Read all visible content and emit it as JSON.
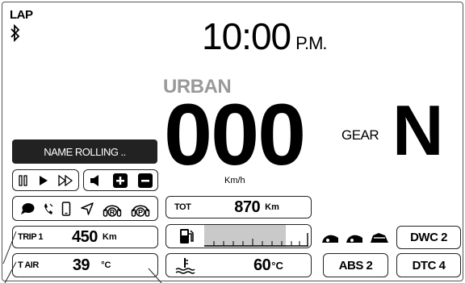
{
  "status": {
    "lap_label": "LAP"
  },
  "clock": {
    "time": "10:00",
    "ampm": "P.M."
  },
  "ride_mode": "URBAN",
  "speed": {
    "value": "000",
    "unit": "Km/h"
  },
  "gear": {
    "label": "GEAR",
    "value": "N"
  },
  "media": {
    "track_name": "NAME ROLLING .."
  },
  "trip": {
    "label": "TRIP 1",
    "value": "450",
    "unit": "Km"
  },
  "air_temp": {
    "label": "T AIR",
    "value": "39",
    "unit": "°C"
  },
  "odometer": {
    "label": "TOT",
    "value": "870",
    "unit": "Km"
  },
  "fuel": {
    "level": 0.78
  },
  "coolant": {
    "value": "60",
    "unit": "°C"
  },
  "systems": {
    "abs": "ABS 2",
    "dtc": "DTC 4",
    "dwc": "DWC 2"
  },
  "icons": {
    "bluetooth": "bluetooth-icon",
    "pause": "pause-icon",
    "play": "play-icon",
    "fast_forward": "fast-forward-icon",
    "speaker": "speaker-icon",
    "volume_up": "volume-up-icon",
    "volume_down": "volume-down-icon",
    "chat": "chat-icon",
    "call": "phone-call-icon",
    "phone": "smartphone-icon",
    "nav": "navigation-icon",
    "rider": "rider-headset-icon",
    "passenger": "passenger-headset-icon",
    "fuel": "fuel-pump-icon",
    "coolant": "coolant-temperature-icon",
    "riding_modes": "riding-mode-icons"
  }
}
